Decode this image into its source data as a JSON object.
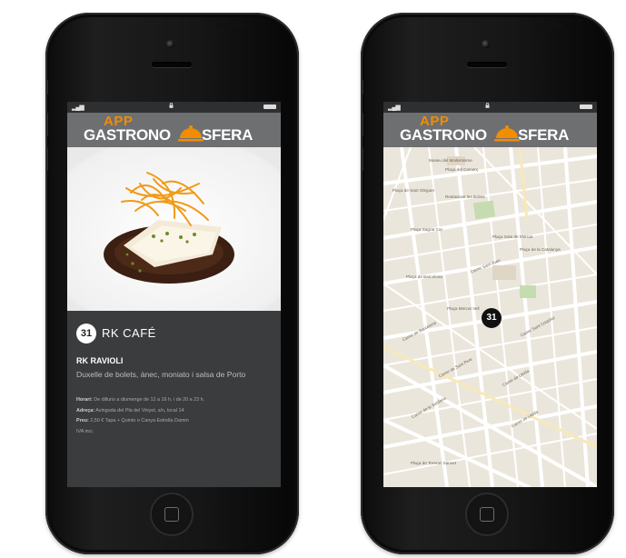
{
  "app": {
    "logo_app": "APP",
    "logo_left": "GASTRONO",
    "logo_right": "SFERA"
  },
  "detail_screen": {
    "number": "31",
    "venue": "RK CAFÉ",
    "dish_name": "RK RAVIOLI",
    "dish_description": "Duxelle de bolets, ànec, moniato i salsa de Porto",
    "hours_label": "Horari:",
    "hours_value": "De dilluns a diumenge de 12 a 16 h. i de 20 a 23 h.",
    "address_label": "Adreça:",
    "address_value": "Avinguda del Pla del Vinyet, s/n, local 14",
    "price_label": "Preu:",
    "price_value": "2,50 € Tapa + Quinto o Canya Estrella Damm",
    "vat_note": "IVA inci."
  },
  "map_screen": {
    "pin_number": "31",
    "labels": [
      "Museu del Modernisme",
      "Plaça del Comerç",
      "Plaça de Sant Oleguer",
      "Restaurant les Bolets",
      "Plaça Sagrat Cor",
      "Plaça de Barcelona",
      "Plaça Sota de Mercat",
      "Plaça Mercat Vell",
      "Plaça de la Catalunya",
      "Carrer Sant Joan",
      "Carrer de Sant Pere",
      "Carrer de Lleida",
      "Carrer de la Sardana",
      "Carrer de Barcelona",
      "Carrer Sant Cristòfol",
      "Carrer de Lleida",
      "Plaça de Toreras Sanxet"
    ]
  },
  "colors": {
    "accent": "#f28c00",
    "screen_bg": "#3b3c3e",
    "header_bg": "#6e6f71",
    "map_bg": "#ebe6dc"
  }
}
